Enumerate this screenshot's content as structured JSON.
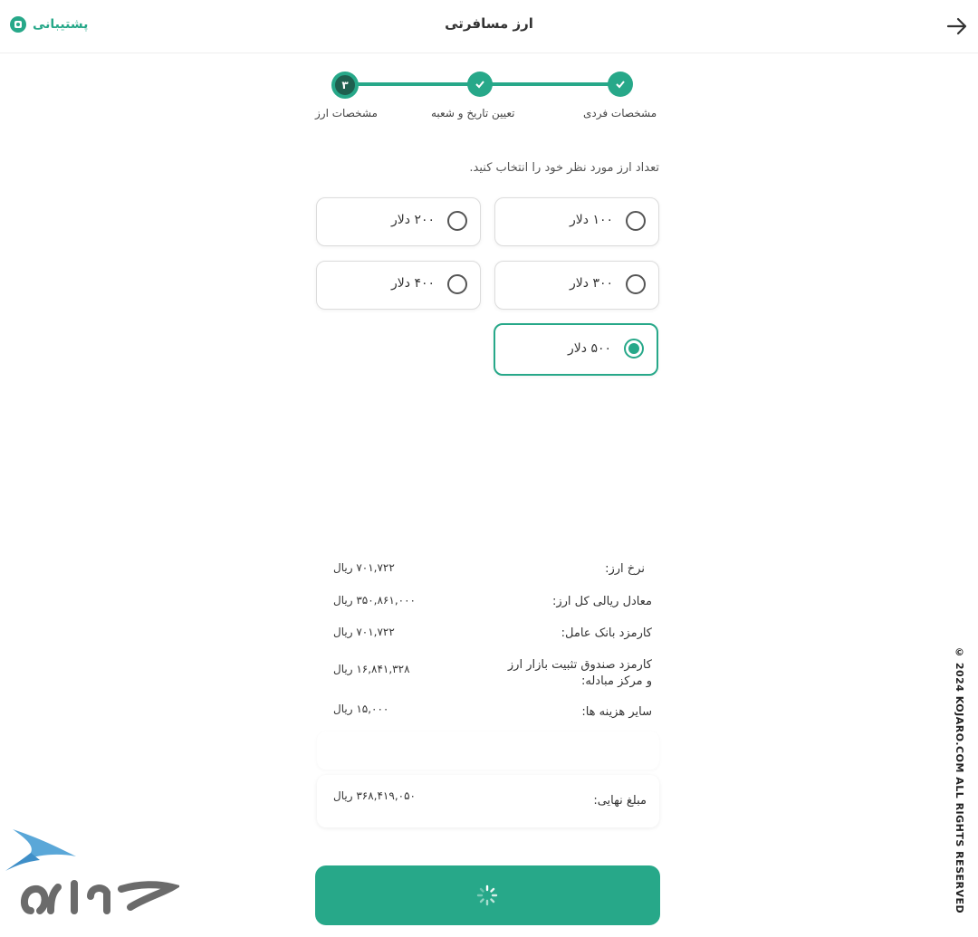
{
  "header": {
    "title": "ارز مسافرتی",
    "support_label": "پشتیبانی"
  },
  "stepper": {
    "steps": [
      {
        "label": "مشخصات فردی",
        "state": "done"
      },
      {
        "label": "تعیین تاریخ و شعبه",
        "state": "done"
      },
      {
        "label": "مشخصات ارز",
        "state": "current",
        "number": "۳"
      }
    ]
  },
  "prompt": "تعداد ارز مورد نظر خود را انتخاب کنید.",
  "options": [
    {
      "label": "۱۰۰ دلار",
      "selected": false
    },
    {
      "label": "۲۰۰ دلار",
      "selected": false
    },
    {
      "label": "۳۰۰ دلار",
      "selected": false
    },
    {
      "label": "۴۰۰ دلار",
      "selected": false
    },
    {
      "label": "۵۰۰ دلار",
      "selected": true
    }
  ],
  "summary": {
    "rows": [
      {
        "label": "نرخ ارز:",
        "value": "۷۰۱,۷۲۲ ریال"
      },
      {
        "label": "معادل ریالی کل ارز:",
        "value": "۳۵۰,۸۶۱,۰۰۰ ریال"
      },
      {
        "label": "کارمزد بانک عامل:",
        "value": "۷۰۱,۷۲۲ ریال"
      },
      {
        "label": "کارمزد صندوق تثبیت بازار ارز و مرکز مبادله:",
        "value": "۱۶,۸۴۱,۳۲۸ ریال"
      },
      {
        "label": "سایر هزینه ها:",
        "value": "۱۵,۰۰۰ ریال"
      }
    ],
    "final": {
      "label": "مبلغ نهایی:",
      "value": "۳۶۸,۴۱۹,۰۵۰ ریال"
    }
  },
  "copyright": "© 2024 KOJARO.COM ALL RIGHTS RESERVED",
  "colors": {
    "accent": "#27a889",
    "accent_dark": "#1f5f4f"
  }
}
